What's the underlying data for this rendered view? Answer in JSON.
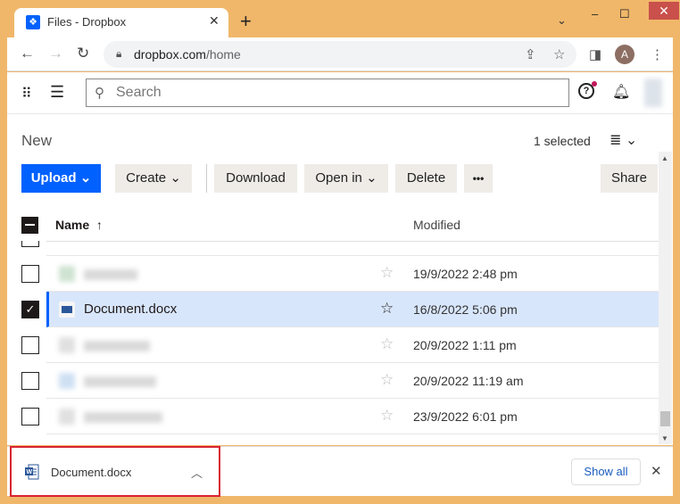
{
  "browser": {
    "tab_title": "Files - Dropbox",
    "url_host": "dropbox.com",
    "url_path": "/home",
    "profile_initial": "A",
    "window_controls": {
      "minimize": "‒",
      "maximize": "☐",
      "close": "✕"
    }
  },
  "app": {
    "search_placeholder": "Search",
    "section_title": "New",
    "selection_count": "1 selected",
    "toolbar": {
      "upload": "Upload",
      "create": "Create",
      "download": "Download",
      "open_in": "Open in",
      "delete": "Delete",
      "more": "•••",
      "share": "Share"
    },
    "table": {
      "col_name": "Name",
      "col_modified": "Modified",
      "sort_indicator": "↑",
      "rows": [
        {
          "name": "",
          "modified": "19/9/2022 2:48 pm",
          "selected": false,
          "starred": false,
          "blurred": true,
          "icon_color": "#cfe3d2"
        },
        {
          "name": "Document.docx",
          "modified": "16/8/2022 5:06 pm",
          "selected": true,
          "starred": true,
          "blurred": false,
          "icon_color": "#2b579a"
        },
        {
          "name": "",
          "modified": "20/9/2022 1:11 pm",
          "selected": false,
          "starred": false,
          "blurred": true,
          "icon_color": "#e0e0e0"
        },
        {
          "name": "",
          "modified": "20/9/2022 11:19 am",
          "selected": false,
          "starred": false,
          "blurred": true,
          "icon_color": "#cfe0f3"
        },
        {
          "name": "",
          "modified": "23/9/2022 6:01 pm",
          "selected": false,
          "starred": false,
          "blurred": true,
          "icon_color": "#e0e0e0"
        }
      ]
    }
  },
  "download_bar": {
    "file_name": "Document.docx",
    "show_all": "Show all"
  },
  "colors": {
    "accent": "#0061fe",
    "selected_row": "#d8e6fb",
    "highlight_box": "#d92332",
    "window_frame": "#f0b76a"
  }
}
